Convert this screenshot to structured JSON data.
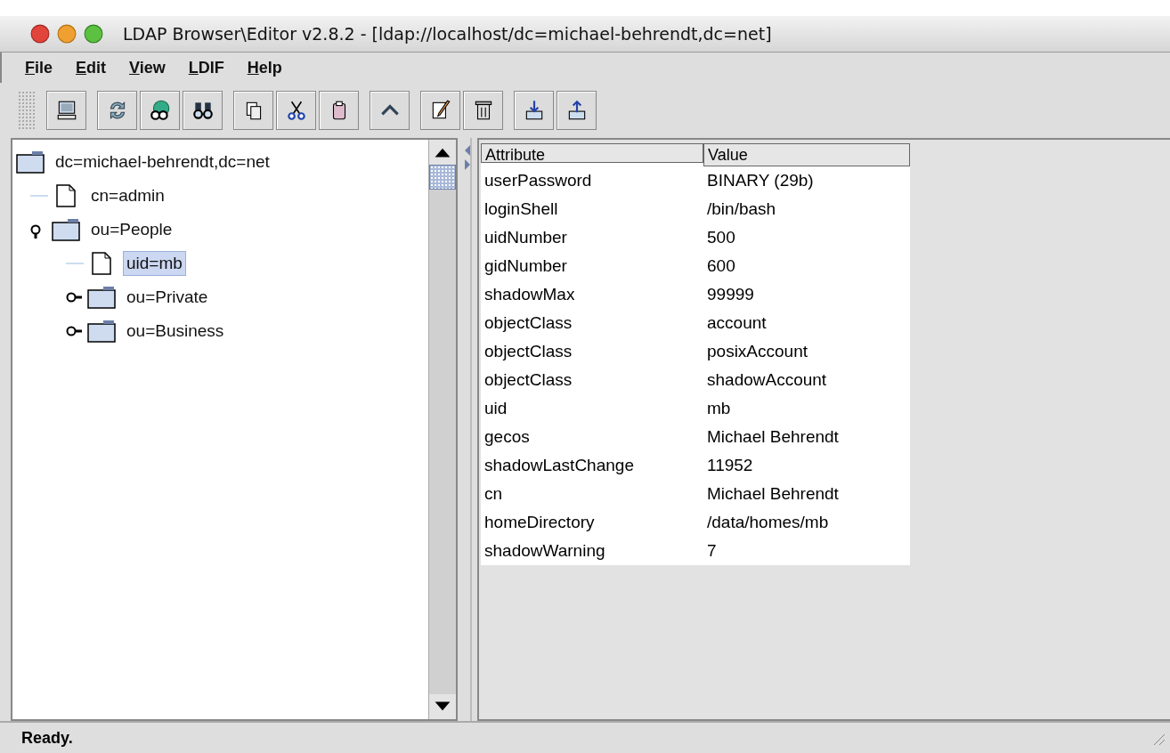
{
  "window": {
    "title": "LDAP Browser\\Editor v2.8.2 - [ldap://localhost/dc=michael-behrendt,dc=net]"
  },
  "menu": [
    "File",
    "Edit",
    "View",
    "LDIF",
    "Help"
  ],
  "toolbar": [
    [
      {
        "kind": "computer"
      }
    ],
    [
      {
        "kind": "refresh"
      },
      {
        "kind": "globe"
      },
      {
        "kind": "binoculars"
      }
    ],
    [
      {
        "kind": "copy"
      },
      {
        "kind": "cut"
      },
      {
        "kind": "paste"
      }
    ],
    [
      {
        "kind": "up"
      }
    ],
    [
      {
        "kind": "edit"
      },
      {
        "kind": "trash"
      }
    ],
    [
      {
        "kind": "import"
      },
      {
        "kind": "export"
      }
    ]
  ],
  "tree": [
    {
      "label": "dc=michael-behrendt,dc=net",
      "kind": "folder",
      "selected": false,
      "children": [
        {
          "label": "cn=admin",
          "kind": "file",
          "selected": false
        },
        {
          "label": "ou=People",
          "kind": "folder",
          "expanded": true,
          "selected": false,
          "children": [
            {
              "label": "uid=mb",
              "kind": "file",
              "selected": true
            },
            {
              "label": "ou=Private",
              "kind": "folder",
              "expanded": false,
              "selected": false
            },
            {
              "label": "ou=Business",
              "kind": "folder",
              "expanded": false,
              "selected": false
            }
          ]
        }
      ]
    }
  ],
  "table": {
    "columns": [
      "Attribute",
      "Value"
    ],
    "rows": [
      [
        "userPassword",
        "BINARY (29b)"
      ],
      [
        "loginShell",
        "/bin/bash"
      ],
      [
        "uidNumber",
        "500"
      ],
      [
        "gidNumber",
        "600"
      ],
      [
        "shadowMax",
        "99999"
      ],
      [
        "objectClass",
        "account"
      ],
      [
        "objectClass",
        "posixAccount"
      ],
      [
        "objectClass",
        "shadowAccount"
      ],
      [
        "uid",
        "mb"
      ],
      [
        "gecos",
        "Michael Behrendt"
      ],
      [
        "shadowLastChange",
        "11952"
      ],
      [
        "cn",
        "Michael Behrendt"
      ],
      [
        "homeDirectory",
        "/data/homes/mb"
      ],
      [
        "shadowWarning",
        "7"
      ]
    ]
  },
  "status_bar": "Ready."
}
